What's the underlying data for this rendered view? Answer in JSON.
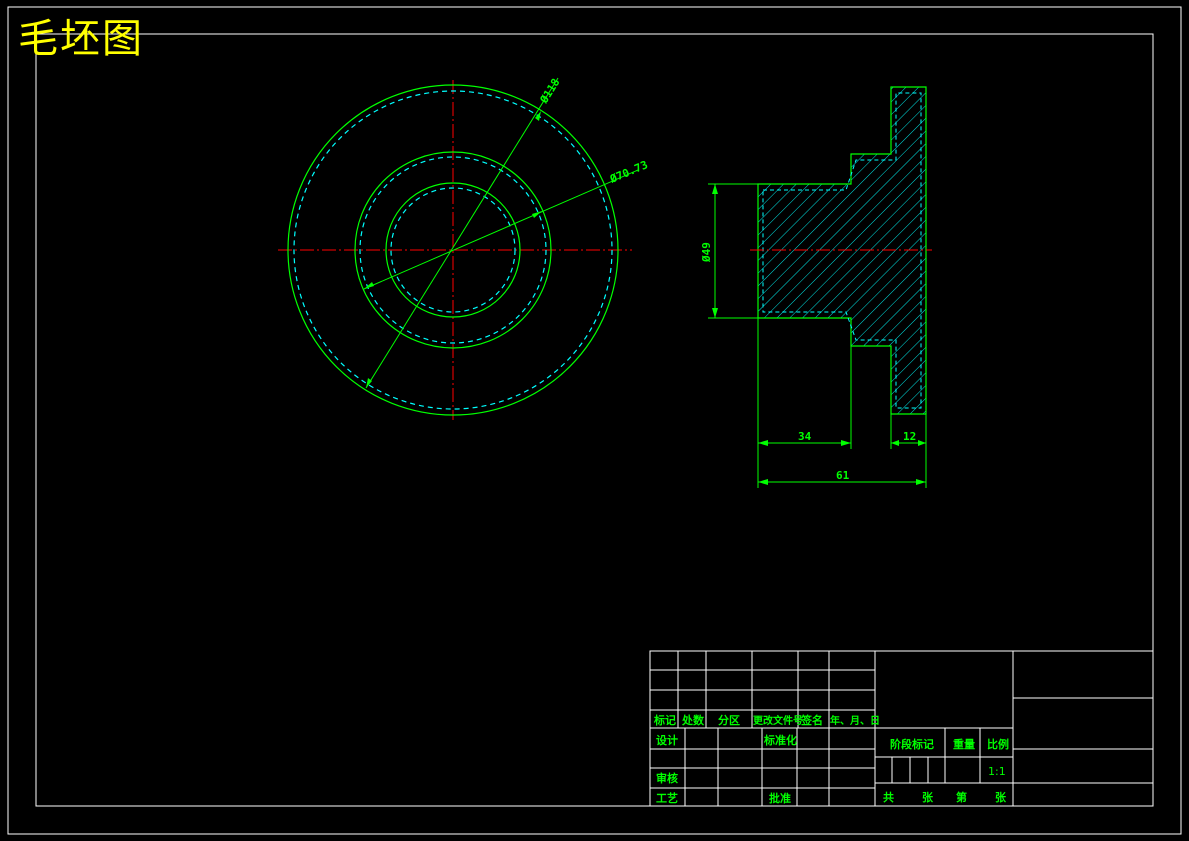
{
  "title": "毛坯图",
  "dimensions": {
    "d118": "Ø118",
    "d70": "Ø70.73",
    "d49": "Ø49",
    "len34": "34",
    "len12": "12",
    "len61": "61"
  },
  "title_block": {
    "mark": "标记",
    "count": "处数",
    "zone": "分区",
    "change_doc": "更改文件号",
    "signature": "签名",
    "date": "年、月、日",
    "design": "设计",
    "standardize": "标准化",
    "review": "审核",
    "process": "工艺",
    "approve": "批准",
    "stage_mark": "阶段标记",
    "weight": "重量",
    "scale_label": "比例",
    "scale_value": "1:1",
    "total": "共",
    "sheets": "张",
    "sheet_no": "第",
    "sheet_unit": "张"
  },
  "colors": {
    "background": "#000000",
    "border": "#ffffff",
    "outline": "#00ff00",
    "centerline": "#ff0000",
    "hatch": "#00ffff",
    "title": "#ffff00"
  }
}
